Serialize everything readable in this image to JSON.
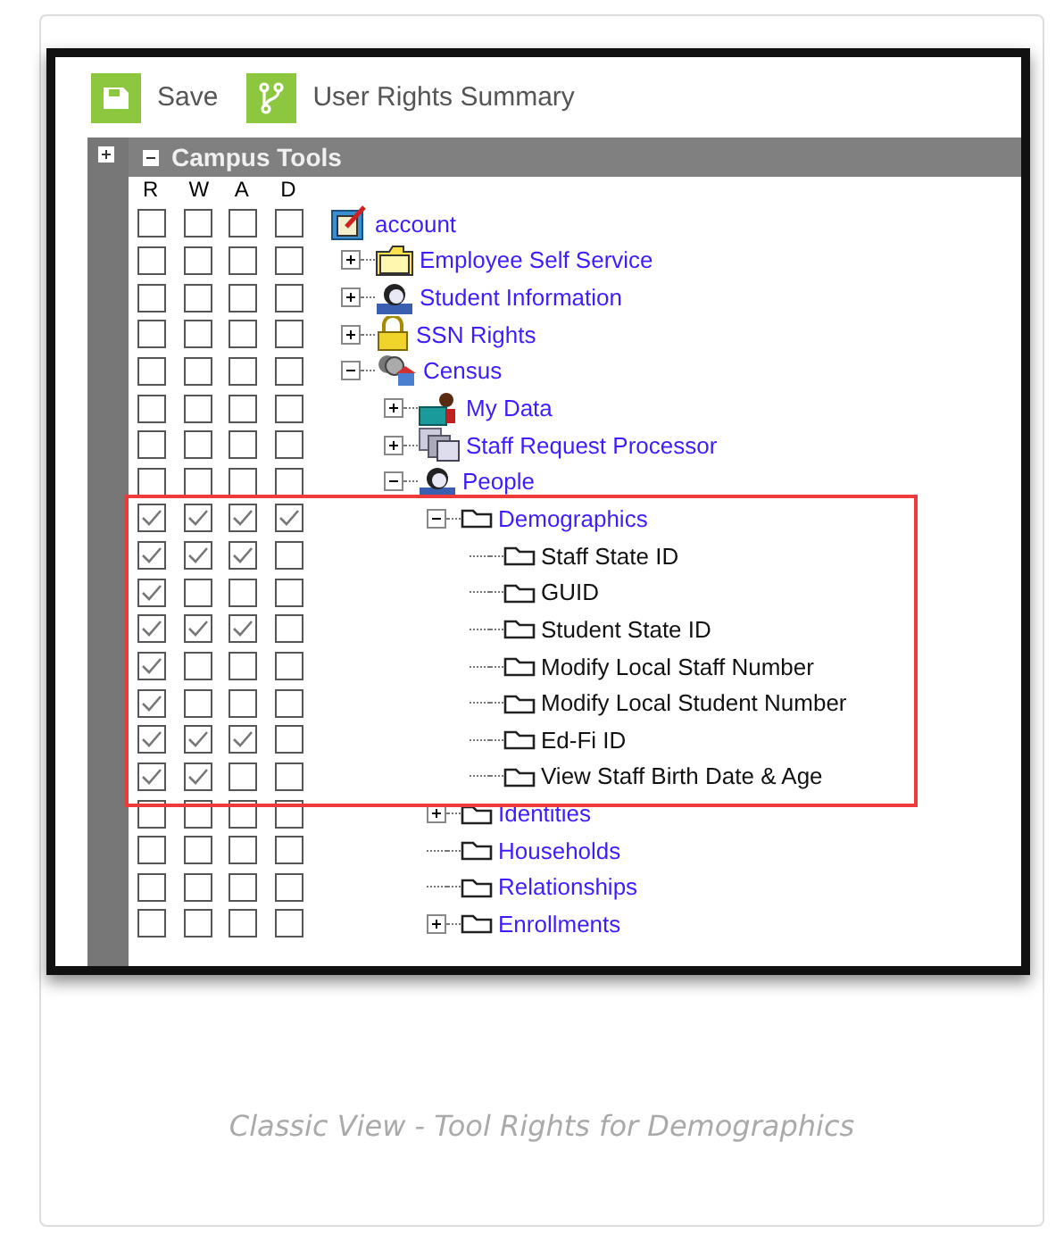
{
  "toolbar": {
    "buttons": [
      {
        "label": "Save",
        "kind": "save"
      },
      {
        "label": "User Rights Summary",
        "kind": "branch"
      }
    ]
  },
  "panel": {
    "title": "Campus Tools",
    "expanded": true
  },
  "columns": [
    "R",
    "W",
    "A",
    "D"
  ],
  "tree": [
    {
      "label": "account",
      "kind": "notepad",
      "link": true,
      "rights": [
        false,
        false,
        false,
        false
      ],
      "highlighted": false,
      "children": [
        {
          "label": "Employee Self Service",
          "kind": "folder",
          "link": true,
          "expanded": false,
          "rights": [
            false,
            false,
            false,
            false
          ],
          "highlighted": false
        },
        {
          "label": "Student Information",
          "kind": "person",
          "link": true,
          "expanded": false,
          "rights": [
            false,
            false,
            false,
            false
          ],
          "highlighted": false
        },
        {
          "label": "SSN Rights",
          "kind": "lock",
          "link": true,
          "expanded": false,
          "rights": [
            false,
            false,
            false,
            false
          ],
          "highlighted": false
        },
        {
          "label": "Census",
          "kind": "census",
          "link": true,
          "expanded": true,
          "rights": [
            false,
            false,
            false,
            false
          ],
          "highlighted": false,
          "children": [
            {
              "label": "My Data",
              "kind": "briefcase",
              "link": true,
              "expanded": false,
              "rights": [
                false,
                false,
                false,
                false
              ],
              "highlighted": false
            },
            {
              "label": "Staff Request Processor",
              "kind": "stack",
              "link": true,
              "expanded": false,
              "rights": [
                false,
                false,
                false,
                false
              ],
              "highlighted": false
            },
            {
              "label": "People",
              "kind": "person",
              "link": true,
              "expanded": true,
              "rights": [
                false,
                false,
                false,
                false
              ],
              "highlighted": false,
              "children": [
                {
                  "label": "Demographics",
                  "kind": "page",
                  "link": true,
                  "expanded": true,
                  "rights": [
                    true,
                    true,
                    true,
                    true
                  ],
                  "highlighted": true,
                  "children": [
                    {
                      "label": "Staff State ID",
                      "kind": "page",
                      "link": false,
                      "rights": [
                        true,
                        true,
                        true,
                        false
                      ],
                      "highlighted": false
                    },
                    {
                      "label": "GUID",
                      "kind": "page",
                      "link": false,
                      "rights": [
                        true,
                        false,
                        false,
                        false
                      ],
                      "highlighted": false
                    },
                    {
                      "label": "Student State ID",
                      "kind": "page",
                      "link": false,
                      "rights": [
                        true,
                        true,
                        true,
                        false
                      ],
                      "highlighted": false
                    },
                    {
                      "label": "Modify Local Staff Number",
                      "kind": "page",
                      "link": false,
                      "rights": [
                        true,
                        false,
                        false,
                        false
                      ],
                      "highlighted": false
                    },
                    {
                      "label": "Modify Local Student Number",
                      "kind": "page",
                      "link": false,
                      "rights": [
                        true,
                        false,
                        false,
                        false
                      ],
                      "highlighted": false
                    },
                    {
                      "label": "Ed-Fi ID",
                      "kind": "page",
                      "link": false,
                      "rights": [
                        true,
                        true,
                        true,
                        false
                      ],
                      "highlighted": false
                    },
                    {
                      "label": "View Staff Birth Date & Age",
                      "kind": "page",
                      "link": false,
                      "rights": [
                        true,
                        true,
                        false,
                        false
                      ],
                      "highlighted": false
                    }
                  ]
                },
                {
                  "label": "Identities",
                  "kind": "page",
                  "link": true,
                  "expanded": false,
                  "rights": [
                    false,
                    false,
                    false,
                    false
                  ],
                  "highlighted": false
                },
                {
                  "label": "Households",
                  "kind": "page",
                  "link": true,
                  "rights": [
                    false,
                    false,
                    false,
                    false
                  ],
                  "highlighted": false
                },
                {
                  "label": "Relationships",
                  "kind": "page",
                  "link": true,
                  "rights": [
                    false,
                    false,
                    false,
                    false
                  ],
                  "highlighted": false
                },
                {
                  "label": "Enrollments",
                  "kind": "page",
                  "link": true,
                  "expanded": false,
                  "rights": [
                    false,
                    false,
                    false,
                    false
                  ],
                  "highlighted": false
                }
              ]
            }
          ]
        }
      ]
    }
  ],
  "caption": "Classic View - Tool Rights for Demographics"
}
